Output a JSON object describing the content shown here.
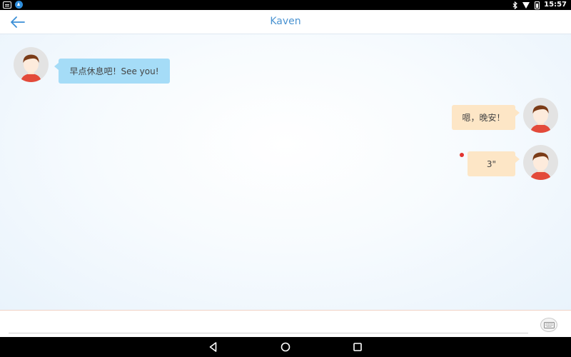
{
  "status_bar": {
    "time": "15:57",
    "left_icons": [
      "message-icon",
      "app-notification-icon"
    ],
    "right_icons": [
      "bluetooth-icon",
      "wifi-icon",
      "battery-icon"
    ]
  },
  "header": {
    "title": "Kaven",
    "back_icon": "arrow-left-icon"
  },
  "messages": [
    {
      "side": "left",
      "type": "text",
      "text": "早点休息吧！See you!"
    },
    {
      "side": "right",
      "type": "text",
      "text": "嗯，晚安！"
    },
    {
      "side": "right",
      "type": "voice",
      "text": "3\"",
      "unread": true
    }
  ],
  "input": {
    "value": "",
    "placeholder": "",
    "toggle_icon": "keyboard-icon"
  },
  "nav_bar": {
    "buttons": [
      "back-triangle-icon",
      "home-circle-icon",
      "recents-square-icon"
    ]
  },
  "colors": {
    "accent": "#4a93d1",
    "left_bubble": "#a5dcf7",
    "right_bubble": "#fde6c6",
    "unread_dot": "#e2332f"
  }
}
